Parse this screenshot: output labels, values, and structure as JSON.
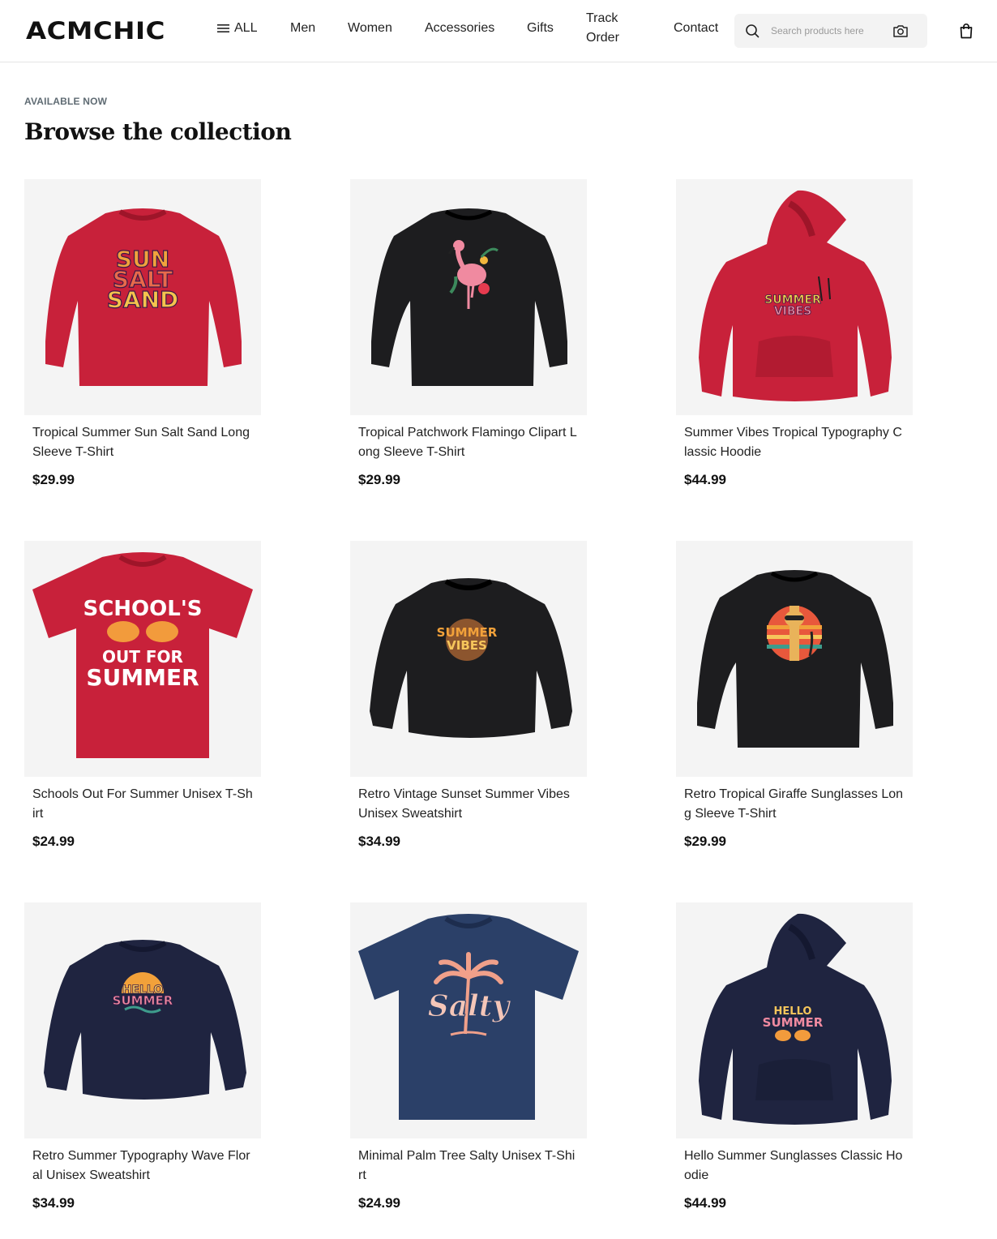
{
  "brand": {
    "logo_text": "ACMCHIC"
  },
  "nav": {
    "all_label": "ALL",
    "items": [
      "Men",
      "Women",
      "Accessories",
      "Gifts"
    ],
    "track_line1": "Track",
    "track_line2": "Order",
    "contact_label": "Contact"
  },
  "search": {
    "placeholder": "Search products here"
  },
  "section": {
    "eyebrow": "AVAILABLE NOW",
    "title": "Browse the collection"
  },
  "products": [
    {
      "name": "Tropical Summer Sun Salt Sand Long Sleeve T-Shirt",
      "price": "$29.99",
      "graphic_text": [
        "SUN",
        "SALT",
        "SAND"
      ]
    },
    {
      "name": "Tropical Patchwork Flamingo Clipart Long Sleeve T-Shirt",
      "price": "$29.99"
    },
    {
      "name": "Summer Vibes Tropical Typography Classic Hoodie",
      "price": "$44.99",
      "graphic_text": [
        "SUMMER",
        "VIBES"
      ]
    },
    {
      "name": "Schools Out For Summer Unisex T-Shirt",
      "price": "$24.99",
      "graphic_text": [
        "SCHOOL'S",
        "OUT FOR",
        "SUMMER"
      ]
    },
    {
      "name": "Retro Vintage Sunset Summer Vibes Unisex Sweatshirt",
      "price": "$34.99",
      "graphic_text": [
        "SUMMER",
        "VIBES"
      ]
    },
    {
      "name": "Retro Tropical Giraffe Sunglasses Long Sleeve T-Shirt",
      "price": "$29.99"
    },
    {
      "name": "Retro Summer Typography Wave Floral Unisex Sweatshirt",
      "price": "$34.99",
      "graphic_text": [
        "HELLO",
        "SUMMER"
      ]
    },
    {
      "name": "Minimal Palm Tree Salty Unisex T-Shirt",
      "price": "$24.99",
      "graphic_text": [
        "Salty"
      ]
    },
    {
      "name": "Hello Summer Sunglasses Classic Hoodie",
      "price": "$44.99",
      "graphic_text": [
        "HELLO",
        "SUMMER"
      ]
    }
  ],
  "colors": {
    "red_garment": "#c8213a",
    "black_garment": "#1d1d1f",
    "navy_garment": "#1f2440",
    "blue_garment": "#2b4068",
    "card_bg": "#f4f4f4"
  }
}
